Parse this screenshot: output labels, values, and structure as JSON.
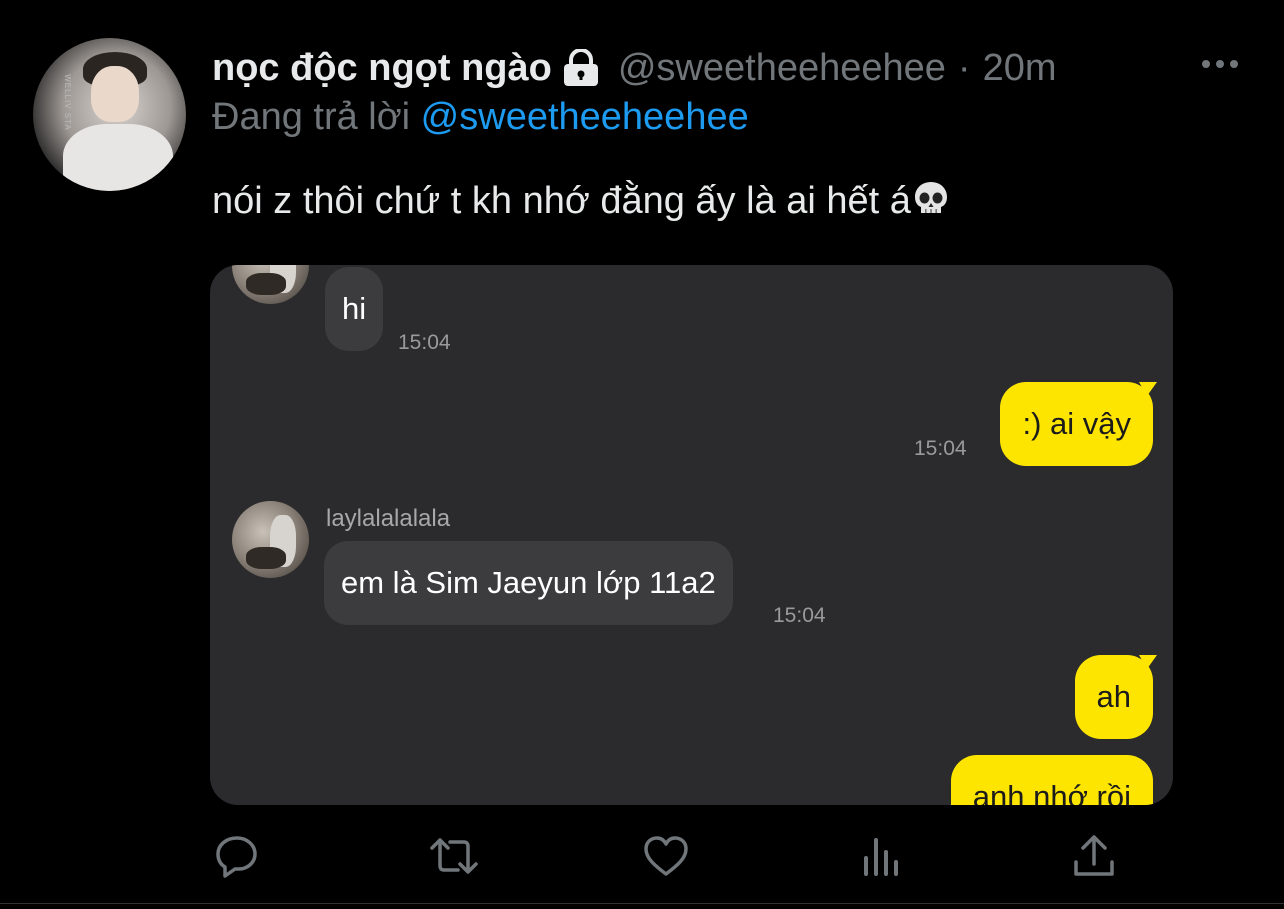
{
  "tweet": {
    "display_name": "nọc độc ngọt ngào",
    "handle": "@sweetheeheehee",
    "separator": "·",
    "time": "20m",
    "reply_prefix": "Đang trả lời",
    "reply_to": "@sweetheeheehee",
    "text": "nói z thôi chứ t kh nhớ đằng ấy là ai hết á",
    "avatar_caption": "WELLIV STA"
  },
  "chat": {
    "messages": [
      {
        "side": "left",
        "text": "hi",
        "time": "15:04"
      },
      {
        "side": "right",
        "text": ":) ai vậy",
        "time": "15:04"
      },
      {
        "side": "left",
        "sender": "laylalalalala",
        "text": "em là Sim Jaeyun lớp 11a2",
        "time": "15:04"
      },
      {
        "side": "right",
        "text": "ah"
      },
      {
        "side": "right",
        "text": "anh nhớ rồi"
      }
    ]
  },
  "icons": {
    "lock": "lock-icon",
    "more": "more-icon",
    "skull": "skull-emoji-icon",
    "reply": "reply-icon",
    "retweet": "retweet-icon",
    "like": "heart-icon",
    "views": "analytics-icon",
    "share": "share-icon"
  },
  "colors": {
    "background": "#000000",
    "link": "#1d9bf0",
    "muted": "#71767b",
    "chat_bg": "#2b2b2d",
    "incoming_bubble": "#3c3c3e",
    "outgoing_bubble": "#fee500"
  }
}
